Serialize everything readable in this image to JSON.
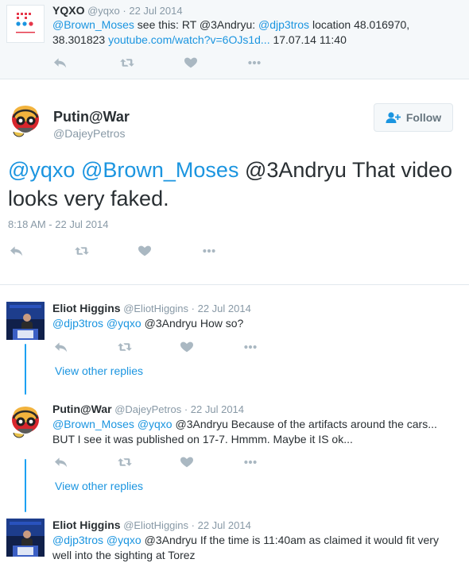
{
  "context_tweet": {
    "name": "YQXO",
    "handle": "@yqxo",
    "date": "22 Jul 2014",
    "text_parts": {
      "m1": "@Brown_Moses",
      "t1": " see this: RT @3Andryu: ",
      "m2": "@djp3tros",
      "t2": " location 48.016970, 38.301823 ",
      "url": "youtube.com/watch?v=6OJs1d...",
      "t3": " 17.07.14 11:40"
    }
  },
  "main_tweet": {
    "name": "Putin@War",
    "handle": "@DajeyPetros",
    "follow_label": "Follow",
    "text_parts": {
      "m1": "@yqxo",
      "m2": "@Brown_Moses",
      "t1": " @3Andryu That video looks very faked."
    },
    "timestamp": "8:18 AM - 22 Jul 2014"
  },
  "replies": [
    {
      "name": "Eliot Higgins",
      "handle": "@EliotHiggins",
      "date": "22 Jul 2014",
      "m1": "@djp3tros",
      "m2": "@yqxo",
      "t1": " @3Andryu How so?",
      "view_replies": "View other replies"
    },
    {
      "name": "Putin@War",
      "handle": "@DajeyPetros",
      "date": "22 Jul 2014",
      "m1": "@Brown_Moses",
      "m2": "@yqxo",
      "t1": " @3Andryu Because of the artifacts around the cars...",
      "line2": "BUT I see it was published on 17-7. Hmmm. Maybe it IS ok...",
      "view_replies": "View other replies"
    },
    {
      "name": "Eliot Higgins",
      "handle": "@EliotHiggins",
      "date": "22 Jul 2014",
      "m1": "@djp3tros",
      "m2": "@yqxo",
      "t1": " @3Andryu If the time is 11:40am as claimed it would fit very",
      "line2": "well into the sighting at Torez"
    }
  ],
  "icons": {
    "reply": "reply-icon",
    "retweet": "retweet-icon",
    "like": "heart-icon",
    "more": "more-icon",
    "follow": "add-user-icon"
  },
  "colors": {
    "link": "#1b95e0",
    "muted": "#8899a6",
    "icon": "#aab8c2",
    "thread": "#1da1f2",
    "context_bg": "#f5f8fa"
  }
}
